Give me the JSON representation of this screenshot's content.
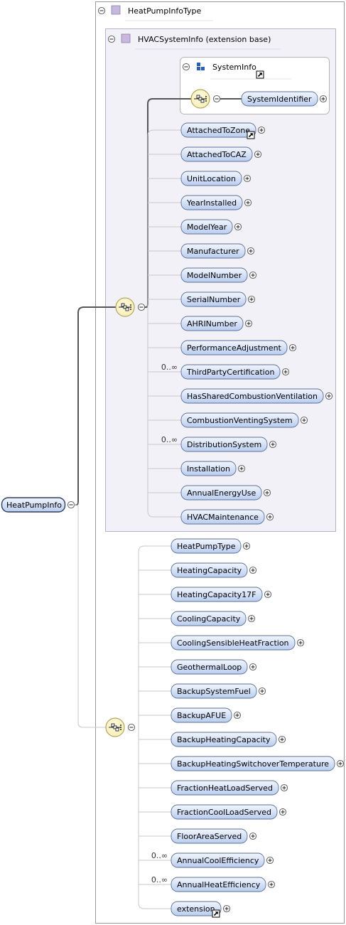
{
  "root": {
    "label": "HeatPumpInfo"
  },
  "type_box": {
    "title": "HeatPumpInfoType"
  },
  "base_box": {
    "title": "HVACSystemInfo (extension base)"
  },
  "systeminfo_box": {
    "title": "SystemInfo",
    "child": {
      "label": "SystemIdentifier"
    }
  },
  "base_elements": [
    {
      "label": "AttachedToZone",
      "card": "",
      "ref": true
    },
    {
      "label": "AttachedToCAZ",
      "card": "",
      "ref": false
    },
    {
      "label": "UnitLocation",
      "card": "",
      "ref": false
    },
    {
      "label": "YearInstalled",
      "card": "",
      "ref": false
    },
    {
      "label": "ModelYear",
      "card": "",
      "ref": false
    },
    {
      "label": "Manufacturer",
      "card": "",
      "ref": false
    },
    {
      "label": "ModelNumber",
      "card": "",
      "ref": false
    },
    {
      "label": "SerialNumber",
      "card": "",
      "ref": false
    },
    {
      "label": "AHRINumber",
      "card": "",
      "ref": false
    },
    {
      "label": "PerformanceAdjustment",
      "card": "",
      "ref": false
    },
    {
      "label": "ThirdPartyCertification",
      "card": "0..∞",
      "ref": false
    },
    {
      "label": "HasSharedCombustionVentilation",
      "card": "",
      "ref": false
    },
    {
      "label": "CombustionVentingSystem",
      "card": "",
      "ref": false
    },
    {
      "label": "DistributionSystem",
      "card": "0..∞",
      "ref": false
    },
    {
      "label": "Installation",
      "card": "",
      "ref": false
    },
    {
      "label": "AnnualEnergyUse",
      "card": "",
      "ref": false
    },
    {
      "label": "HVACMaintenance",
      "card": "",
      "ref": false
    }
  ],
  "ext_elements": [
    {
      "label": "HeatPumpType",
      "card": "",
      "ref": false
    },
    {
      "label": "HeatingCapacity",
      "card": "",
      "ref": false
    },
    {
      "label": "HeatingCapacity17F",
      "card": "",
      "ref": false
    },
    {
      "label": "CoolingCapacity",
      "card": "",
      "ref": false
    },
    {
      "label": "CoolingSensibleHeatFraction",
      "card": "",
      "ref": false
    },
    {
      "label": "GeothermalLoop",
      "card": "",
      "ref": false
    },
    {
      "label": "BackupSystemFuel",
      "card": "",
      "ref": false
    },
    {
      "label": "BackupAFUE",
      "card": "",
      "ref": false
    },
    {
      "label": "BackupHeatingCapacity",
      "card": "",
      "ref": false
    },
    {
      "label": "BackupHeatingSwitchoverTemperature",
      "card": "",
      "ref": false
    },
    {
      "label": "FractionHeatLoadServed",
      "card": "",
      "ref": false
    },
    {
      "label": "FractionCoolLoadServed",
      "card": "",
      "ref": false
    },
    {
      "label": "FloorAreaServed",
      "card": "",
      "ref": false
    },
    {
      "label": "AnnualCoolEfficiency",
      "card": "0..∞",
      "ref": false
    },
    {
      "label": "AnnualHeatEfficiency",
      "card": "0..∞",
      "ref": false
    },
    {
      "label": "extension",
      "card": "",
      "ref": true
    }
  ],
  "colors": {
    "node_fill_top": "#f2f6fe",
    "node_fill_bottom": "#b9cdef",
    "node_stroke": "#5a6f95",
    "connector": "#c8c8c8",
    "main_connector": "#555555",
    "outer_box_fill": "#ffffff",
    "base_box_fill": "#f3f1f8",
    "base_box_stroke": "#b7b1cc",
    "systeminfo_box_fill": "#ffffff",
    "type_icon": "#c9b8de",
    "systeminfo_icon": "#2c5fb5",
    "compositor_fill": "#f6edb6",
    "compositor_stroke": "#a29645"
  },
  "icons": {
    "collapse": "minus-circle-icon",
    "expand": "plus-circle-icon",
    "reference": "reference-arrow-icon",
    "sequence": "sequence-compositor-icon",
    "complex_type": "complex-type-icon",
    "group": "group-icon"
  }
}
